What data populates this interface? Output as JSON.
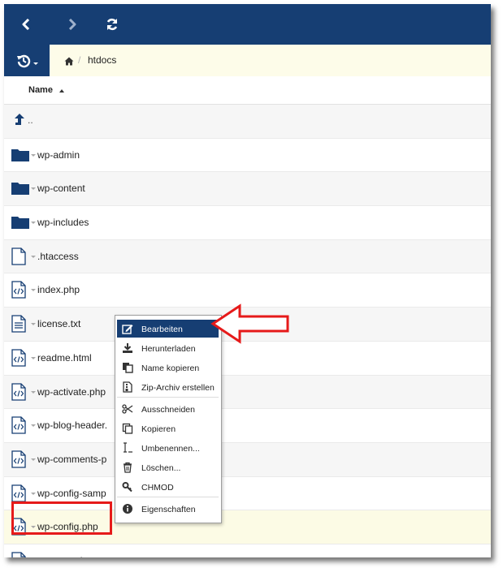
{
  "toolbar": {
    "back_icon": "chevron-left-icon",
    "forward_icon": "chevron-right-icon",
    "refresh_icon": "refresh-icon",
    "background": "#163e73"
  },
  "breadcrumb": {
    "history_icon": "history-icon",
    "home_icon": "home-icon",
    "separator": "/",
    "current": "htdocs"
  },
  "columns": {
    "name_label": "Name"
  },
  "files": [
    {
      "name": "..",
      "type": "parent"
    },
    {
      "name": "wp-admin",
      "type": "folder"
    },
    {
      "name": "wp-content",
      "type": "folder"
    },
    {
      "name": "wp-includes",
      "type": "folder"
    },
    {
      "name": ".htaccess",
      "type": "file"
    },
    {
      "name": "index.php",
      "type": "code"
    },
    {
      "name": "license.txt",
      "type": "text"
    },
    {
      "name": "readme.html",
      "type": "code"
    },
    {
      "name": "wp-activate.php",
      "type": "code"
    },
    {
      "name": "wp-blog-header.",
      "type": "code"
    },
    {
      "name": "wp-comments-p",
      "type": "code"
    },
    {
      "name": "wp-config-samp",
      "type": "code"
    },
    {
      "name": "wp-config.php",
      "type": "code",
      "selected": true
    },
    {
      "name": "wp-cron.php",
      "type": "code"
    }
  ],
  "context_menu": {
    "items": [
      {
        "label": "Bearbeiten",
        "icon": "edit-icon",
        "active": true
      },
      {
        "label": "Herunterladen",
        "icon": "download-icon"
      },
      {
        "label": "Name kopieren",
        "icon": "copy-name-icon"
      },
      {
        "label": "Zip-Archiv erstellen",
        "icon": "zip-icon"
      },
      {
        "label": "Ausschneiden",
        "icon": "scissors-icon"
      },
      {
        "label": "Kopieren",
        "icon": "copy-icon"
      },
      {
        "label": "Umbenennen...",
        "icon": "rename-icon"
      },
      {
        "label": "Löschen...",
        "icon": "trash-icon"
      },
      {
        "label": "CHMOD",
        "icon": "key-icon"
      },
      {
        "label": "Eigenschaften",
        "icon": "info-icon"
      }
    ]
  },
  "annotation_color": "#e61a1a"
}
